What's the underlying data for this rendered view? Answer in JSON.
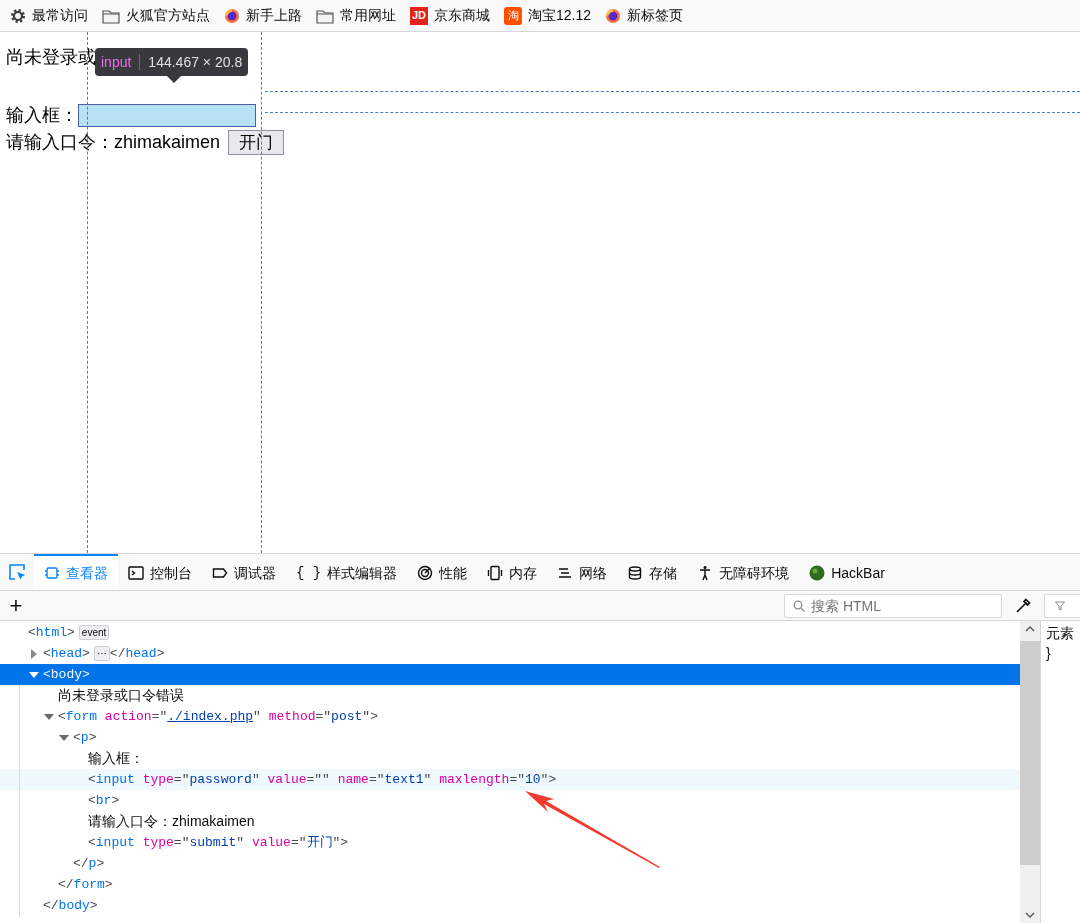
{
  "bookmarks": [
    {
      "kind": "gear",
      "label": "最常访问"
    },
    {
      "kind": "folder",
      "label": "火狐官方站点"
    },
    {
      "kind": "firefox",
      "label": "新手上路"
    },
    {
      "kind": "folder",
      "label": "常用网址"
    },
    {
      "kind": "jd",
      "label": "京东商城",
      "icon_text": "JD"
    },
    {
      "kind": "taobao",
      "label": "淘宝12.12",
      "icon_text": "淘"
    },
    {
      "kind": "firefox",
      "label": "新标签页"
    }
  ],
  "page": {
    "status_text": "尚未登录或",
    "field_label": "输入框：",
    "field_highlighted": true,
    "hint_text": "请输入口令：zhimakaimen",
    "submit_button": "开门"
  },
  "tooltip": {
    "tag": "input",
    "size": "144.467 × 20.8"
  },
  "devtools": {
    "tabs": [
      {
        "kind": "inspector",
        "label": "查看器",
        "selected": true
      },
      {
        "kind": "console",
        "label": "控制台",
        "selected": false
      },
      {
        "kind": "debugger",
        "label": "调试器",
        "selected": false
      },
      {
        "kind": "style",
        "label": "样式编辑器",
        "selected": false,
        "icon_text": "{ }"
      },
      {
        "kind": "performance",
        "label": "性能",
        "selected": false
      },
      {
        "kind": "memory",
        "label": "内存",
        "selected": false
      },
      {
        "kind": "network",
        "label": "网络",
        "selected": false
      },
      {
        "kind": "storage",
        "label": "存储",
        "selected": false
      },
      {
        "kind": "accessibility",
        "label": "无障碍环境",
        "selected": false
      },
      {
        "kind": "hackbar",
        "label": "HackBar",
        "selected": false
      }
    ],
    "add_button": "+",
    "search": {
      "placeholder": "搜索 HTML"
    },
    "tree": [
      {
        "open": [
          {
            "kind": "punct",
            "t": "<"
          },
          {
            "kind": "tag",
            "t": "html"
          },
          {
            "kind": "punct",
            "t": ">"
          }
        ],
        "badge": "event",
        "children": [
          {
            "open": [
              {
                "kind": "punct",
                "t": "<"
              },
              {
                "kind": "tag",
                "t": "head"
              },
              {
                "kind": "punct",
                "t": ">"
              }
            ],
            "badge": "⋯",
            "inline_close": [
              {
                "kind": "punct",
                "t": "</"
              },
              {
                "kind": "tag",
                "t": "head"
              },
              {
                "kind": "punct",
                "t": ">"
              }
            ],
            "expanded": false,
            "selected": false
          },
          {
            "open": [
              {
                "kind": "punct",
                "t": "<"
              },
              {
                "kind": "tag",
                "t": "body"
              },
              {
                "kind": "punct",
                "t": ">"
              }
            ],
            "expanded": true,
            "selected": true,
            "children": [
              {
                "text": "尚未登录或口令错误"
              },
              {
                "open": [
                  {
                    "kind": "punct",
                    "t": "<"
                  },
                  {
                    "kind": "tag",
                    "t": "form"
                  },
                  {
                    "kind": "attr",
                    "t": " action"
                  },
                  {
                    "kind": "punct",
                    "t": "=\""
                  },
                  {
                    "kind": "link",
                    "t": "./index.php"
                  },
                  {
                    "kind": "punct",
                    "t": "\""
                  },
                  {
                    "kind": "attr",
                    "t": " method"
                  },
                  {
                    "kind": "punct",
                    "t": "=\""
                  },
                  {
                    "kind": "value",
                    "t": "post"
                  },
                  {
                    "kind": "punct",
                    "t": "\">"
                  }
                ],
                "expanded": true,
                "selected": false,
                "children": [
                  {
                    "open": [
                      {
                        "kind": "punct",
                        "t": "<"
                      },
                      {
                        "kind": "tag",
                        "t": "p"
                      },
                      {
                        "kind": "punct",
                        "t": ">"
                      }
                    ],
                    "expanded": true,
                    "selected": false,
                    "children": [
                      {
                        "text": "输入框："
                      },
                      {
                        "open": [
                          {
                            "kind": "punct",
                            "t": "<"
                          },
                          {
                            "kind": "tag",
                            "t": "input"
                          },
                          {
                            "kind": "attr",
                            "t": " type"
                          },
                          {
                            "kind": "punct",
                            "t": "=\""
                          },
                          {
                            "kind": "value",
                            "t": "password"
                          },
                          {
                            "kind": "punct",
                            "t": "\""
                          },
                          {
                            "kind": "attr",
                            "t": " value"
                          },
                          {
                            "kind": "punct",
                            "t": "=\"\""
                          },
                          {
                            "kind": "attr",
                            "t": " name"
                          },
                          {
                            "kind": "punct",
                            "t": "=\""
                          },
                          {
                            "kind": "value",
                            "t": "text1"
                          },
                          {
                            "kind": "punct",
                            "t": "\""
                          },
                          {
                            "kind": "attr",
                            "t": " maxlength"
                          },
                          {
                            "kind": "punct",
                            "t": "=\""
                          },
                          {
                            "kind": "value",
                            "t": "10"
                          },
                          {
                            "kind": "punct",
                            "t": "\">"
                          }
                        ],
                        "hovered": true
                      },
                      {
                        "open": [
                          {
                            "kind": "punct",
                            "t": "<"
                          },
                          {
                            "kind": "tag",
                            "t": "br"
                          },
                          {
                            "kind": "punct",
                            "t": ">"
                          }
                        ]
                      },
                      {
                        "text": "请输入口令：zhimakaimen"
                      },
                      {
                        "open": [
                          {
                            "kind": "punct",
                            "t": "<"
                          },
                          {
                            "kind": "tag",
                            "t": "input"
                          },
                          {
                            "kind": "attr",
                            "t": " type"
                          },
                          {
                            "kind": "punct",
                            "t": "=\""
                          },
                          {
                            "kind": "value",
                            "t": "submit"
                          },
                          {
                            "kind": "punct",
                            "t": "\""
                          },
                          {
                            "kind": "attr",
                            "t": " value"
                          },
                          {
                            "kind": "punct",
                            "t": "=\""
                          },
                          {
                            "kind": "value",
                            "t": "开门"
                          },
                          {
                            "kind": "punct",
                            "t": "\">"
                          }
                        ]
                      }
                    ],
                    "close": [
                      {
                        "kind": "punct",
                        "t": "</"
                      },
                      {
                        "kind": "tag",
                        "t": "p"
                      },
                      {
                        "kind": "punct",
                        "t": ">"
                      }
                    ]
                  }
                ],
                "close": [
                  {
                    "kind": "punct",
                    "t": "</"
                  },
                  {
                    "kind": "tag",
                    "t": "form"
                  },
                  {
                    "kind": "punct",
                    "t": ">"
                  }
                ]
              }
            ],
            "close": [
              {
                "kind": "punct",
                "t": "</"
              },
              {
                "kind": "tag",
                "t": "body"
              },
              {
                "kind": "punct",
                "t": ">"
              }
            ]
          }
        ]
      }
    ],
    "rules": [
      "元素",
      "}"
    ]
  }
}
